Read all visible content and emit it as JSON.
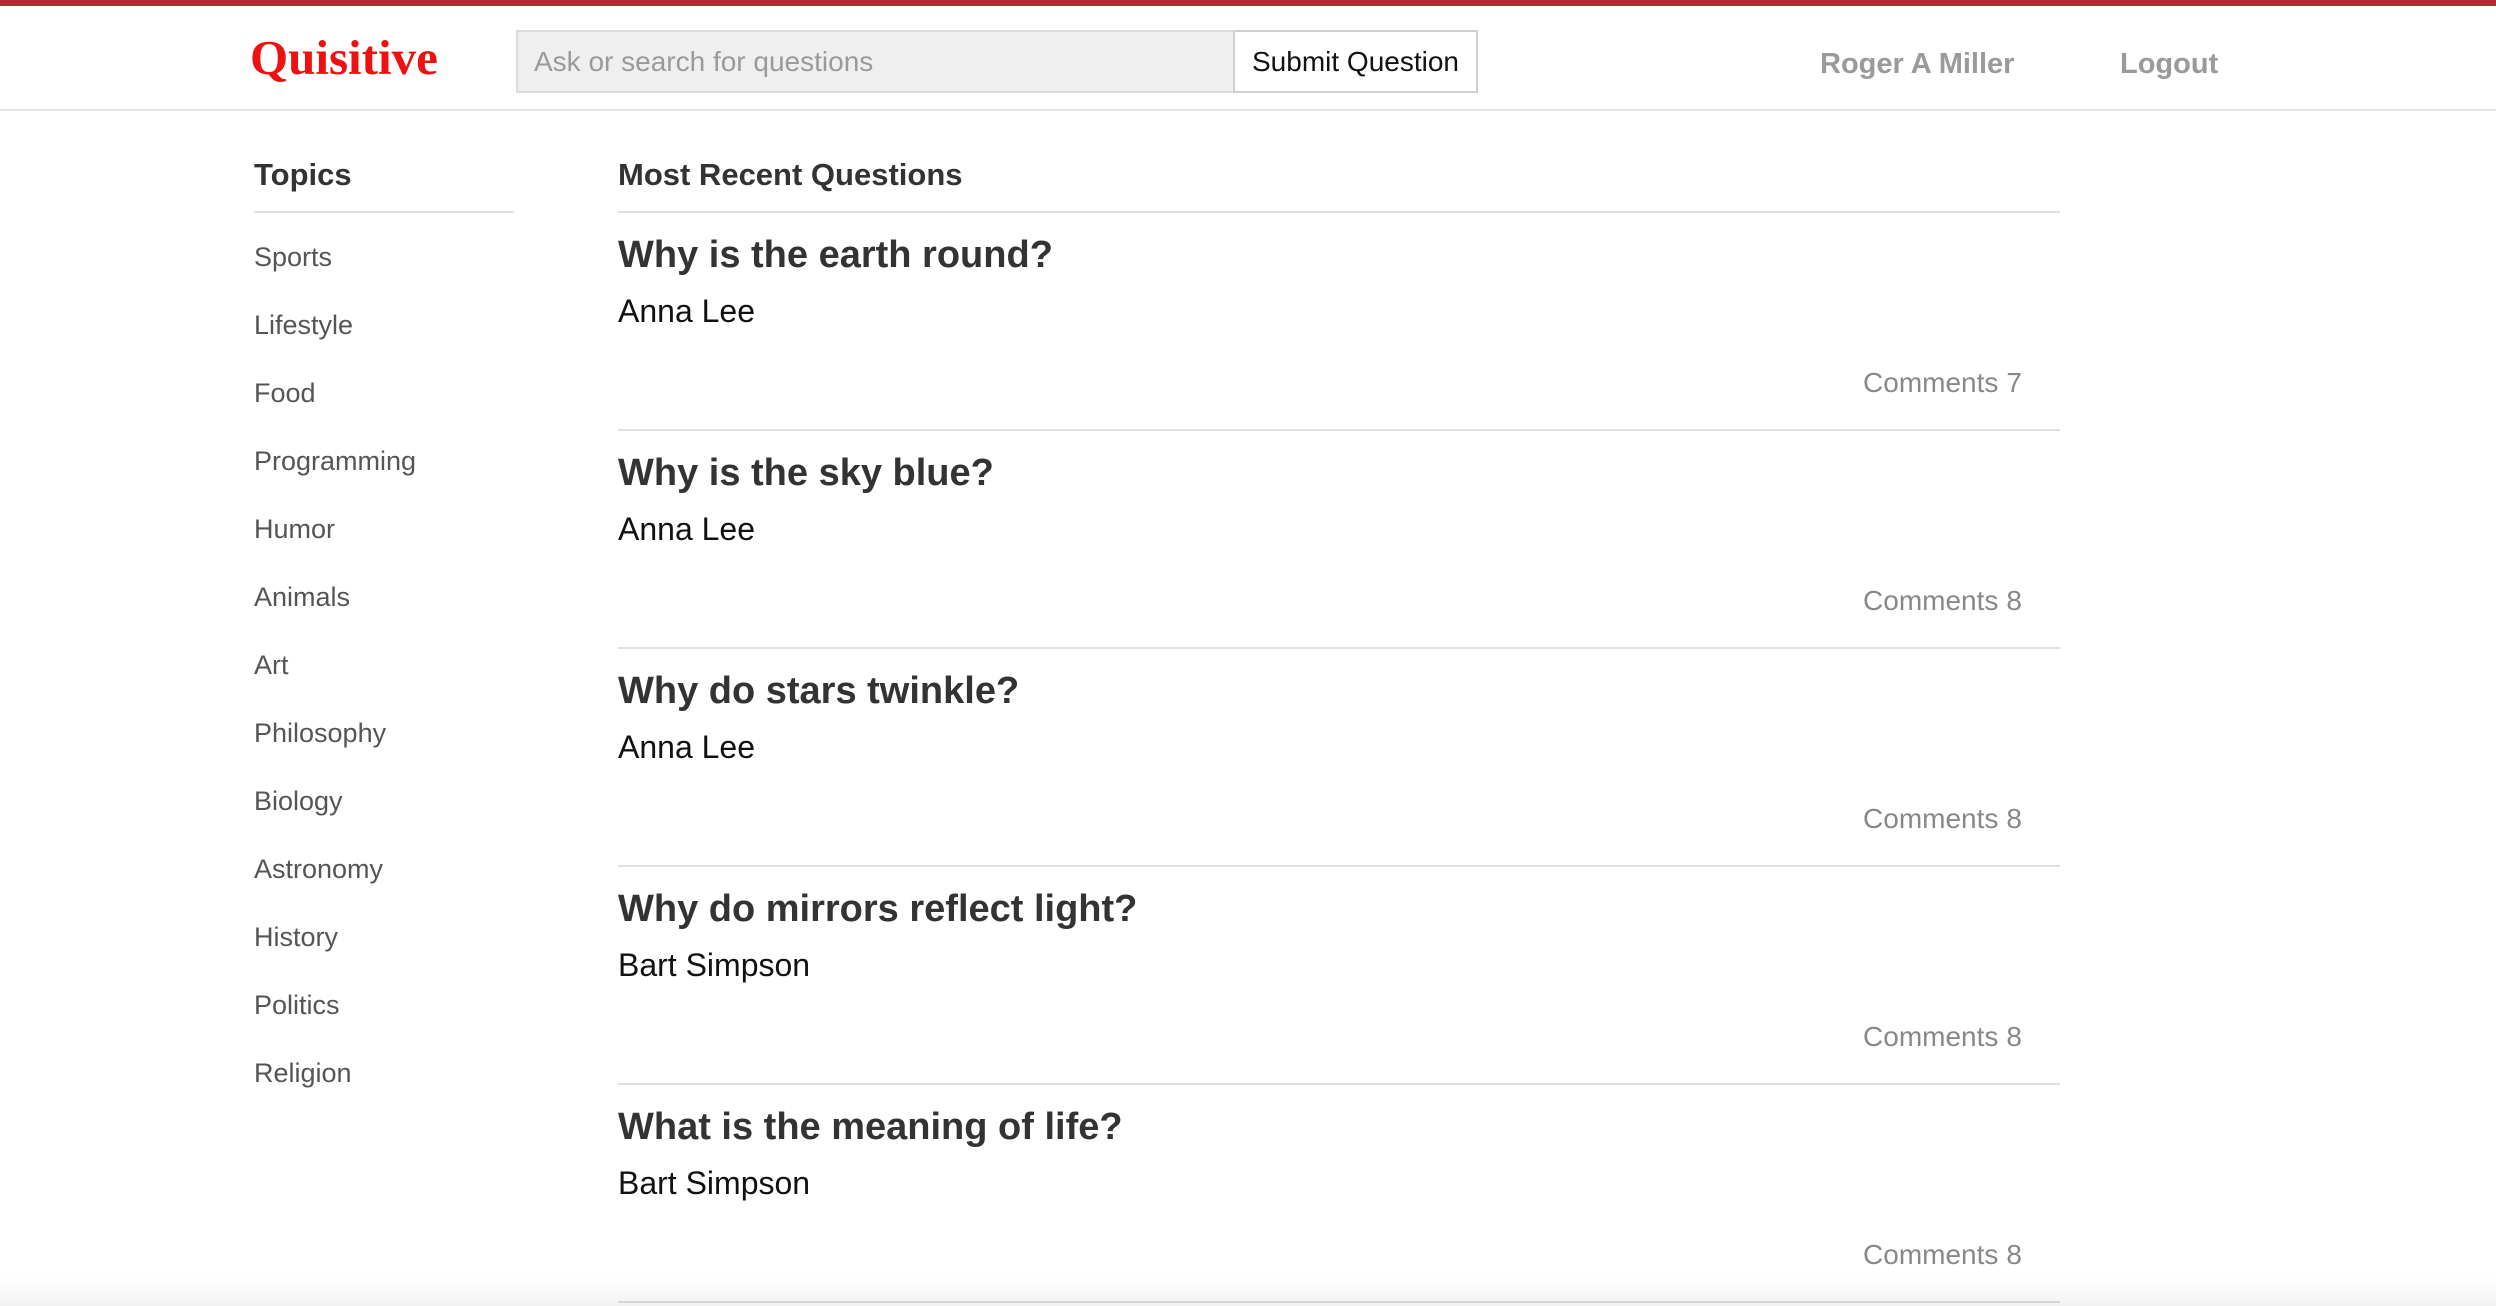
{
  "colors": {
    "brand": "#ee1111",
    "top_border": "#a83232",
    "muted": "#9a9a9a"
  },
  "header": {
    "brand": "Quisitive",
    "search_placeholder": "Ask or search for questions",
    "search_value": "",
    "submit_label": "Submit Question",
    "user_name": "Roger A Miller",
    "logout_label": "Logout"
  },
  "sidebar": {
    "title": "Topics",
    "items": [
      {
        "label": "Sports"
      },
      {
        "label": "Lifestyle"
      },
      {
        "label": "Food"
      },
      {
        "label": "Programming"
      },
      {
        "label": "Humor"
      },
      {
        "label": "Animals"
      },
      {
        "label": "Art"
      },
      {
        "label": "Philosophy"
      },
      {
        "label": "Biology"
      },
      {
        "label": "Astronomy"
      },
      {
        "label": "History"
      },
      {
        "label": "Politics"
      },
      {
        "label": "Religion"
      }
    ]
  },
  "feed": {
    "title": "Most Recent Questions",
    "comments_label": "Comments",
    "questions": [
      {
        "title": "Why is the earth round?",
        "author": "Anna Lee",
        "comments": "7"
      },
      {
        "title": "Why is the sky blue?",
        "author": "Anna Lee",
        "comments": "8"
      },
      {
        "title": "Why do stars twinkle?",
        "author": "Anna Lee",
        "comments": "8"
      },
      {
        "title": "Why do mirrors reflect light?",
        "author": "Bart Simpson",
        "comments": "8"
      },
      {
        "title": "What is the meaning of life?",
        "author": "Bart Simpson",
        "comments": "8"
      }
    ]
  }
}
